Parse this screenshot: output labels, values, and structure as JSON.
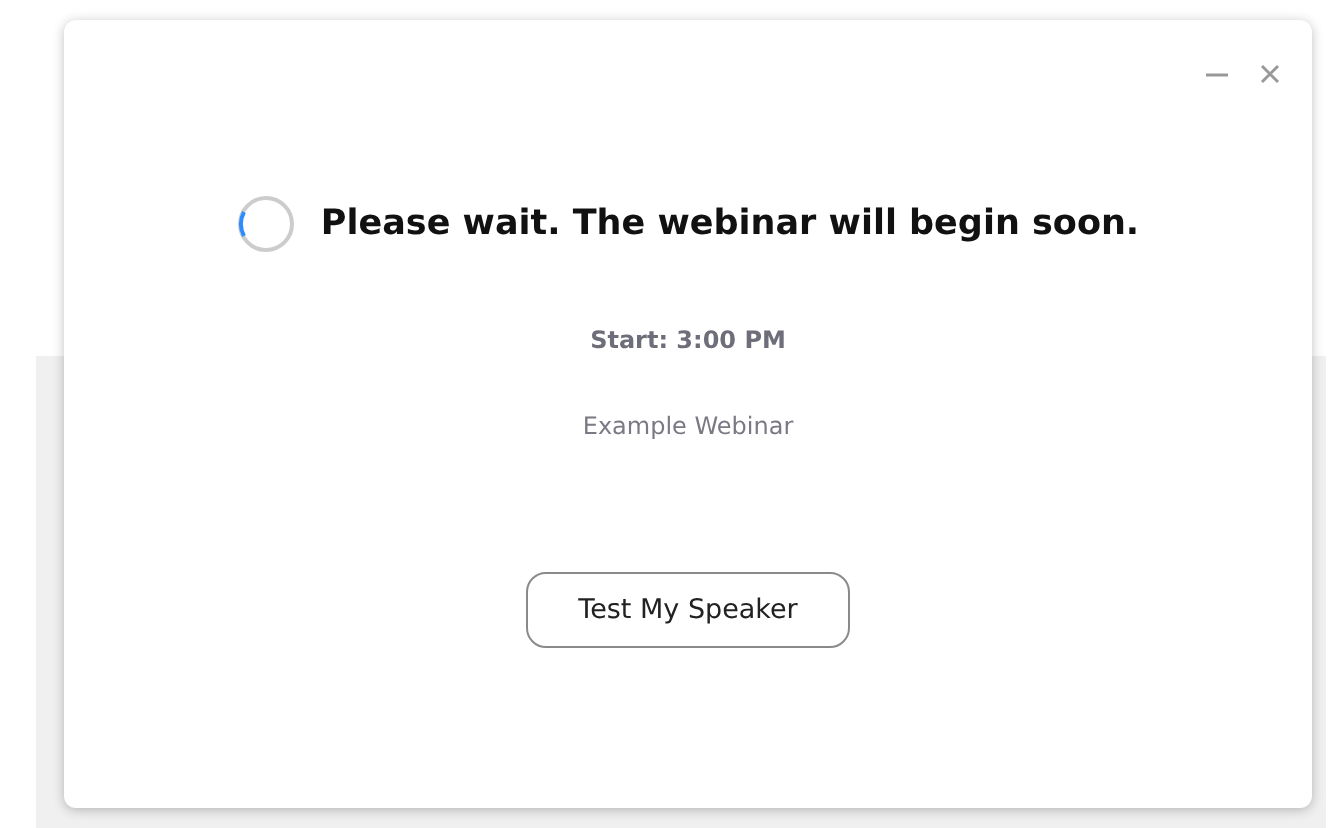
{
  "dialog": {
    "heading": "Please wait. The webinar will begin soon.",
    "start_time": "Start: 3:00 PM",
    "webinar_name": "Example Webinar",
    "buttons": [
      "Test My Speaker"
    ]
  }
}
